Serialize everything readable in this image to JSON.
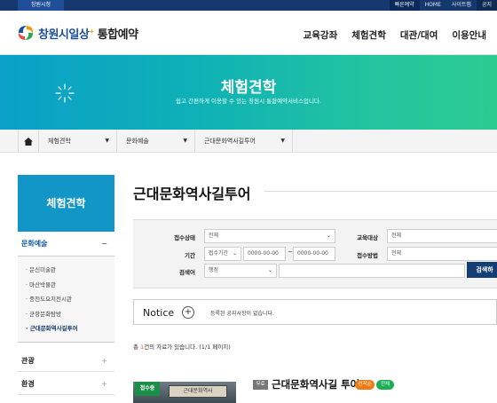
{
  "topbar": {
    "city_label": "창원시청",
    "reserve_label": "빠른예약",
    "home_label": "HOME",
    "sitemap_label": "사이트맵",
    "notice_label": "공지"
  },
  "header": {
    "logo_main": "창원시일상",
    "logo_mark": "+",
    "logo_sub": "통합예약",
    "nav": [
      "교육강좌",
      "체험견학",
      "대관/대여",
      "이용안내"
    ]
  },
  "banner": {
    "title": "체험견학",
    "subtitle": "쉽고 간편하게 이용할 수 있는 창원시 통합예약서비스입니다."
  },
  "breadcrumb": [
    "체험견학",
    "문화예술",
    "근대문화역사길투어"
  ],
  "sidebar": {
    "heading": "체험견학",
    "category": "문화예술",
    "category_toggle": "−",
    "sub_items": [
      "문신미술관",
      "마산박물관",
      "중천도요지전시관",
      "군항문화탐방",
      "근대문화역사길투어"
    ],
    "menus": [
      "관광",
      "환경"
    ],
    "menu_toggle": "+"
  },
  "main": {
    "title": "근대문화역사길투어",
    "search": {
      "status_label": "접수상태",
      "status_value": "전체",
      "target_label": "교육대상",
      "target_value": "전체",
      "period_label": "기간",
      "period_type": "접수기간",
      "date_from": "0000-00-00",
      "date_to": "0000-00-00",
      "tilde": "~",
      "method_label": "접수방법",
      "method_value": "전체",
      "keyword_label": "검색어",
      "keyword_type": "행정",
      "button": "검색하"
    },
    "notice": {
      "title": "Notice",
      "plus": "+",
      "text": "등록된 공지사항이 없습니다."
    },
    "count": {
      "prefix": "총 ",
      "number": "1",
      "suffix": "건의 자료가 있습니다. (1/1 페이지)"
    },
    "card": {
      "badge": "접수중",
      "thumb_sign": "근대문화역사",
      "type": "무료",
      "title": "근대문화역사길 투어",
      "tags": [
        "선착순",
        "전체"
      ]
    }
  }
}
